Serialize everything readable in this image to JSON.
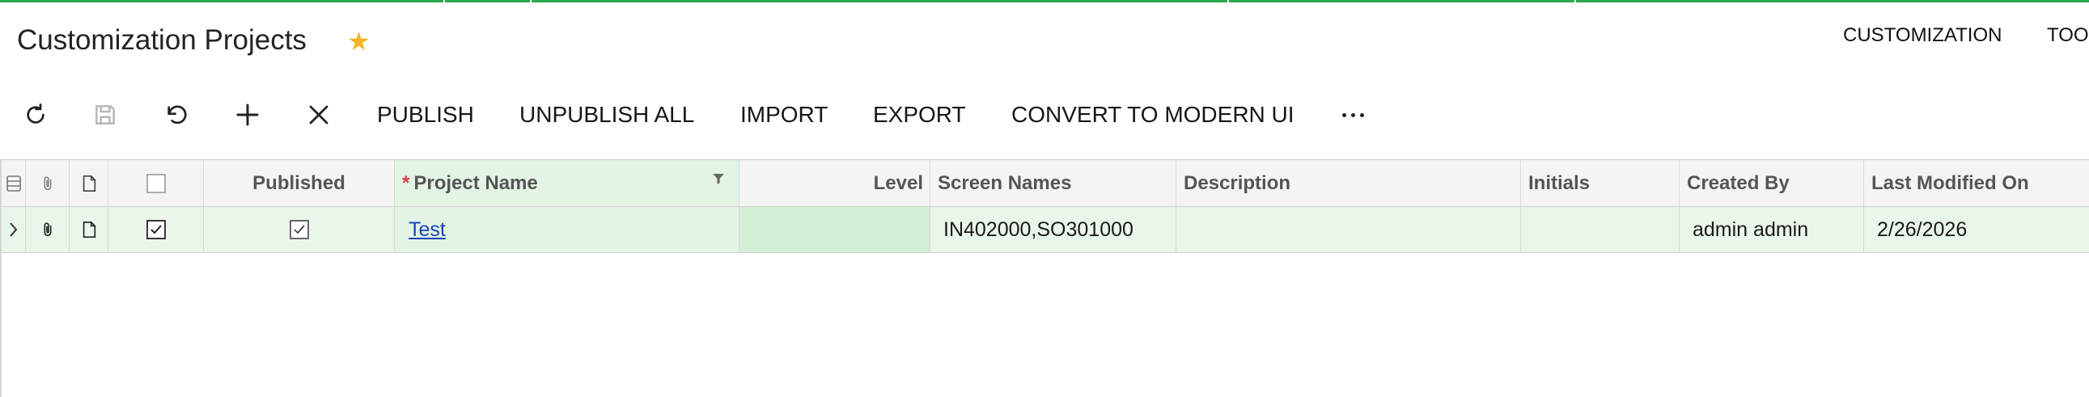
{
  "page": {
    "title": "Customization Projects"
  },
  "header_nav": [
    "CUSTOMIZATION",
    "TOO"
  ],
  "toolbar": {
    "icons": [
      "refresh-icon",
      "save-icon",
      "undo-icon",
      "add-icon",
      "delete-icon",
      "more-icon"
    ],
    "buttons": [
      "PUBLISH",
      "UNPUBLISH ALL",
      "IMPORT",
      "EXPORT",
      "CONVERT TO MODERN UI"
    ]
  },
  "table": {
    "columns": [
      "Published",
      "Project Name",
      "Level",
      "Screen Names",
      "Description",
      "Initials",
      "Created By",
      "Last Modified On"
    ],
    "rows": [
      {
        "selected": true,
        "published": true,
        "project_name": "Test",
        "level": "",
        "screen_names": "IN402000,SO301000",
        "description": "",
        "initials": "",
        "created_by": "admin admin",
        "last_modified_on": "2/26/2026"
      }
    ]
  },
  "colors": {
    "accent_green": "#2ba84a",
    "star": "#f5b325",
    "row_highlight": "#eaf6ea",
    "link": "#1a44b8"
  }
}
